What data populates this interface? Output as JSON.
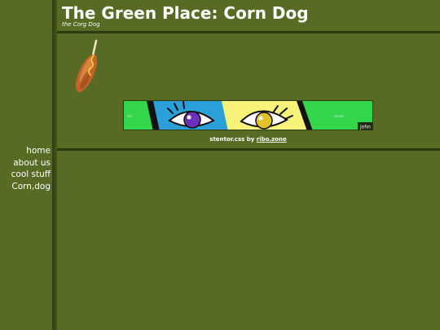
{
  "header": {
    "title": "The Green Place: Corn Dog",
    "subtitle": "the Corg Dog"
  },
  "nav": {
    "items": [
      "home",
      "about us",
      "cool stuff",
      "Corn,dog"
    ]
  },
  "banner": {
    "tag": "john",
    "icon": "eyes-banner"
  },
  "footer": {
    "prefix": "stentor.css by ",
    "link_text": "ribo.zone"
  },
  "images": {
    "corndog": "corndog-image"
  },
  "colors": {
    "background": "#576b25",
    "divider": "#2c3a10",
    "text": "#ffffff",
    "banner_green": "#33d64a",
    "banner_blue": "#2b9fd8",
    "banner_yellow": "#f7f27a"
  }
}
